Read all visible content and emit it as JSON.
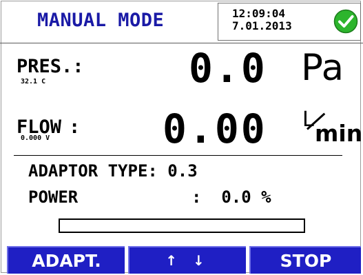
{
  "header": {
    "mode": "MANUAL MODE",
    "time": "12:09:04",
    "date": "7.01.2013",
    "status_icon": "check-circle-icon",
    "status_color": "#2db52d"
  },
  "pressure": {
    "label": "PRES.:",
    "temperature": "32.1 C",
    "value": "0.0",
    "unit": "Pa"
  },
  "flow": {
    "label": "FLOW",
    "colon": ":",
    "voltage": "0.000 V",
    "value": "0.00",
    "unit_top": "L",
    "unit_bottom": "min"
  },
  "info": {
    "adaptor_line": "ADAPTOR TYPE: 0.3",
    "power_label": "POWER",
    "power_line": ":  0.0 %"
  },
  "power_progress": 0.0,
  "buttons": {
    "adapt": "ADAPT.",
    "arrows": "↑ ↓",
    "stop": "STOP"
  },
  "colors": {
    "accent": "#1a1aa6",
    "button": "#1f1fc4",
    "ok": "#2db52d"
  }
}
